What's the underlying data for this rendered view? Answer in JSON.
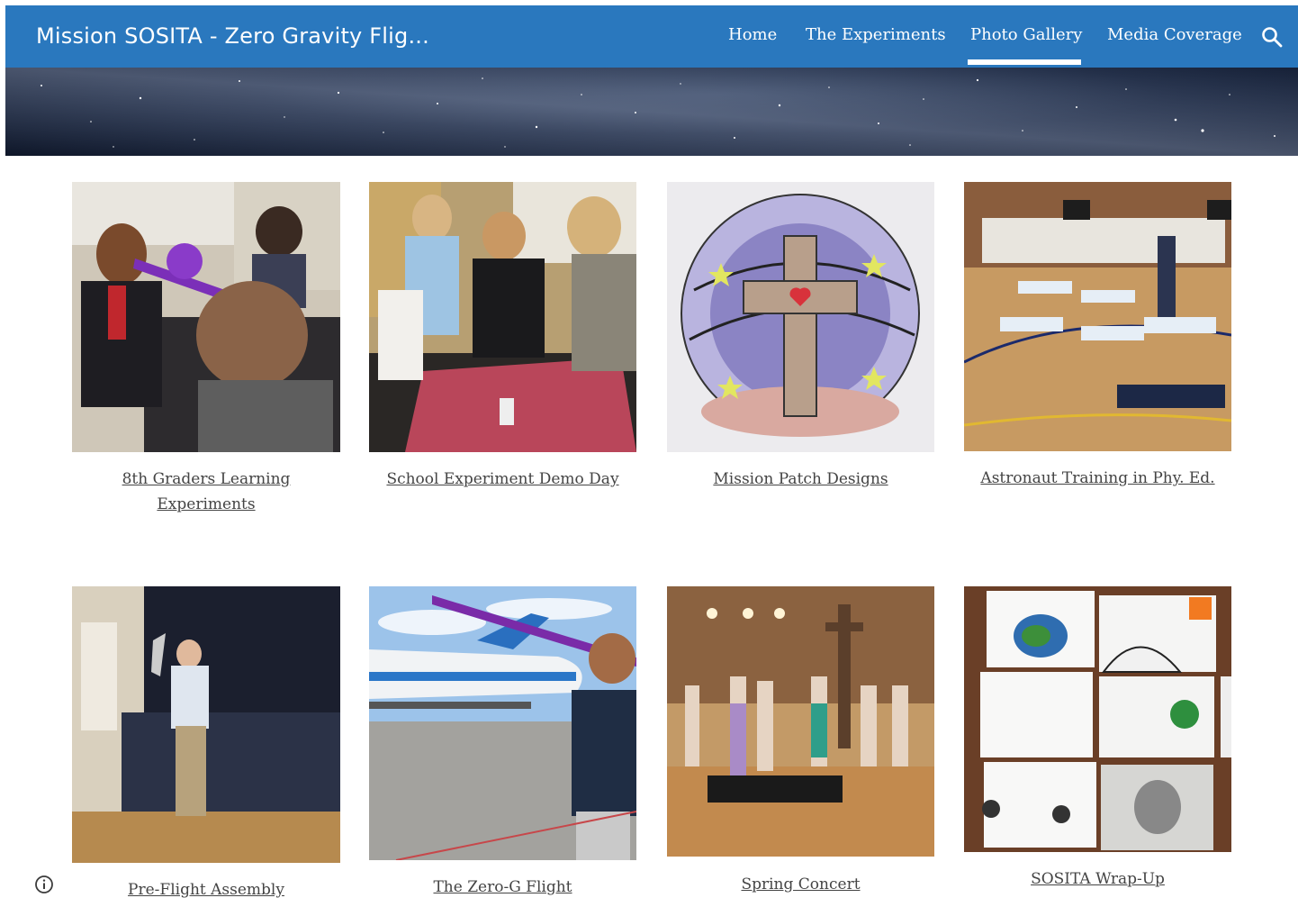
{
  "header": {
    "site_title": "Mission SOSITA - Zero Gravity Flig...",
    "nav": [
      {
        "label": "Home",
        "active": false
      },
      {
        "label": "The Experiments",
        "active": false
      },
      {
        "label": "Photo Gallery",
        "active": true
      },
      {
        "label": "Media Coverage",
        "active": false
      }
    ],
    "search_icon": "search-icon",
    "bar_color": "#2a78be"
  },
  "gallery": [
    {
      "caption_line1": "8th Graders Learning",
      "caption_line2": "Experiments"
    },
    {
      "caption_line1": "School Experiment Demo Day",
      "caption_line2": ""
    },
    {
      "caption_line1": "Mission Patch Designs",
      "caption_line2": ""
    },
    {
      "caption_line1": "Astronaut Training in Phy. Ed.",
      "caption_line2": ""
    },
    {
      "caption_line1": "Pre-Flight Assembly",
      "caption_line2": ""
    },
    {
      "caption_line1": "The Zero-G Flight",
      "caption_line2": ""
    },
    {
      "caption_line1": "Spring Concert",
      "caption_line2": ""
    },
    {
      "caption_line1": "SOSITA Wrap-Up",
      "caption_line2": ""
    }
  ],
  "footer": {
    "info_icon": "info-icon"
  }
}
